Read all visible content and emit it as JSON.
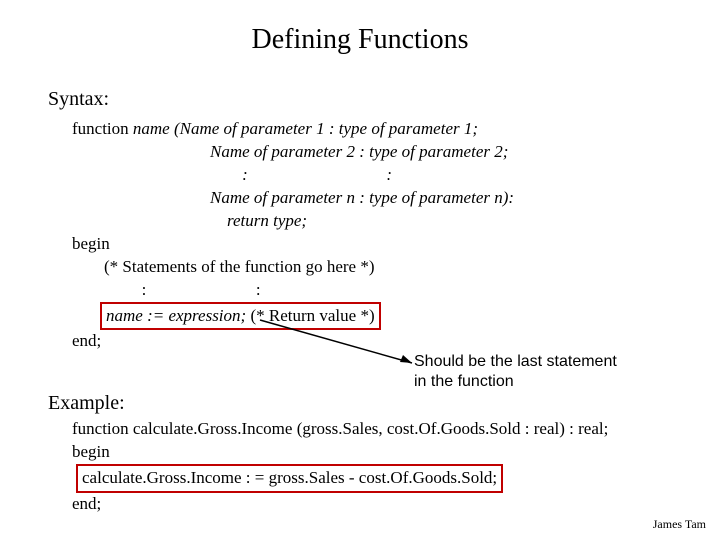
{
  "title": "Defining Functions",
  "labels": {
    "syntax": "Syntax:",
    "example": "Example:"
  },
  "syntax": {
    "kw_function": "function ",
    "line1_rest": "name (Name of parameter 1 : type of parameter 1;",
    "line2": "Name of parameter 2 : type of parameter 2;",
    "dots_left": ":",
    "dots_right": ":",
    "line4": "Name of parameter n : type of parameter n):",
    "line5": "return type;",
    "kw_begin": "begin",
    "stmt_comment": "(* Statements of the function go here *)",
    "stmt_dots_left": ":",
    "stmt_dots_right": ":",
    "return_line_italic": "name := expression;",
    "return_line_rest": " (* Return value *)",
    "kw_end": "end;"
  },
  "annotation": {
    "line1": "Should be the last statement",
    "line2": "in the function"
  },
  "example": {
    "kw_function": "function",
    "sig": " calculate.Gross.Income (gross.Sales, cost.Of.Goods.Sold : real) : real;",
    "kw_begin": "begin",
    "body": "calculate.Gross.Income : = gross.Sales - cost.Of.Goods.Sold;",
    "kw_end": "end;"
  },
  "footer": "James Tam"
}
